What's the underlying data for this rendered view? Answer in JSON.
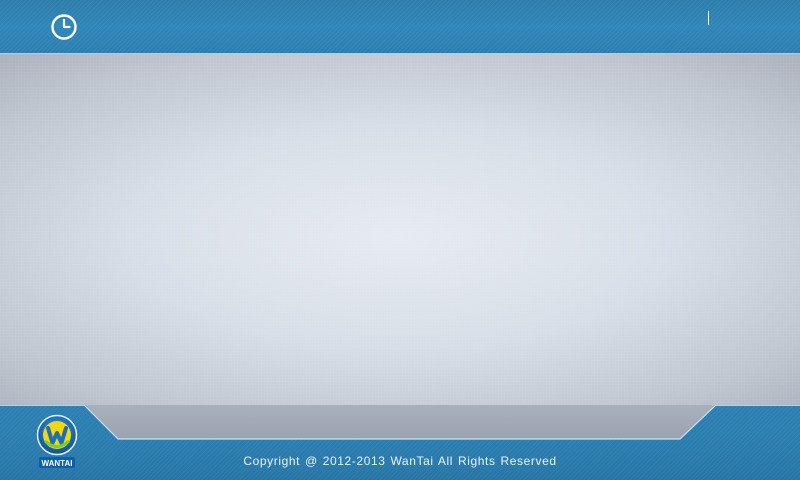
{
  "header": {
    "clock_icon": "clock-icon"
  },
  "footer": {
    "copyright": "Copyright @ 2012-2013 WanTai   All Rights Reserved",
    "logo_letter": "W",
    "logo_text": "WANTAI"
  },
  "colors": {
    "bar_blue": "#2c7fb1",
    "content_grey": "#d8dee7",
    "logo_yellow": "#f2d80f",
    "logo_green": "#7ccf2a"
  }
}
